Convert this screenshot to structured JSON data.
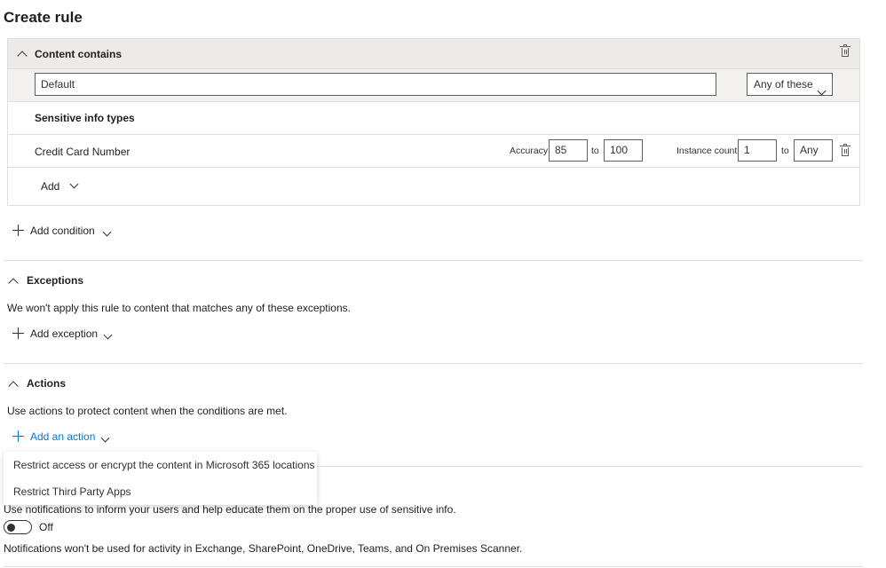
{
  "page": {
    "title": "Create rule"
  },
  "content_contains": {
    "header": "Content contains",
    "group_name": "Default",
    "match_select": "Any of these",
    "sit_header": "Sensitive info types",
    "items": [
      {
        "name": "Credit Card Number",
        "accuracy_label": "Accuracy",
        "accuracy_min": "85",
        "to_label": "to",
        "accuracy_max": "100",
        "instance_label": "Instance count",
        "instance_min": "1",
        "instance_max": "Any"
      }
    ],
    "add_label": "Add"
  },
  "add_condition": "Add condition",
  "exceptions": {
    "title": "Exceptions",
    "description": "We won't apply this rule to content that matches any of these exceptions.",
    "add_label": "Add exception"
  },
  "actions": {
    "title": "Actions",
    "description": "Use actions to protect content when the conditions are met.",
    "add_label": "Add an action",
    "menu_items": [
      "Restrict access or encrypt the content in Microsoft 365 locations",
      "Restrict Third Party Apps"
    ]
  },
  "notifications": {
    "description": "Use notifications to inform your users and help educate them on the proper use of sensitive info.",
    "toggle_state": "Off",
    "note": "Notifications won't be used for activity in Exchange, SharePoint, OneDrive, Teams, and On Premises Scanner."
  },
  "colors": {
    "link": "#0078d4",
    "header_bg": "#edebe9",
    "row_bg": "#f3f2f1"
  }
}
